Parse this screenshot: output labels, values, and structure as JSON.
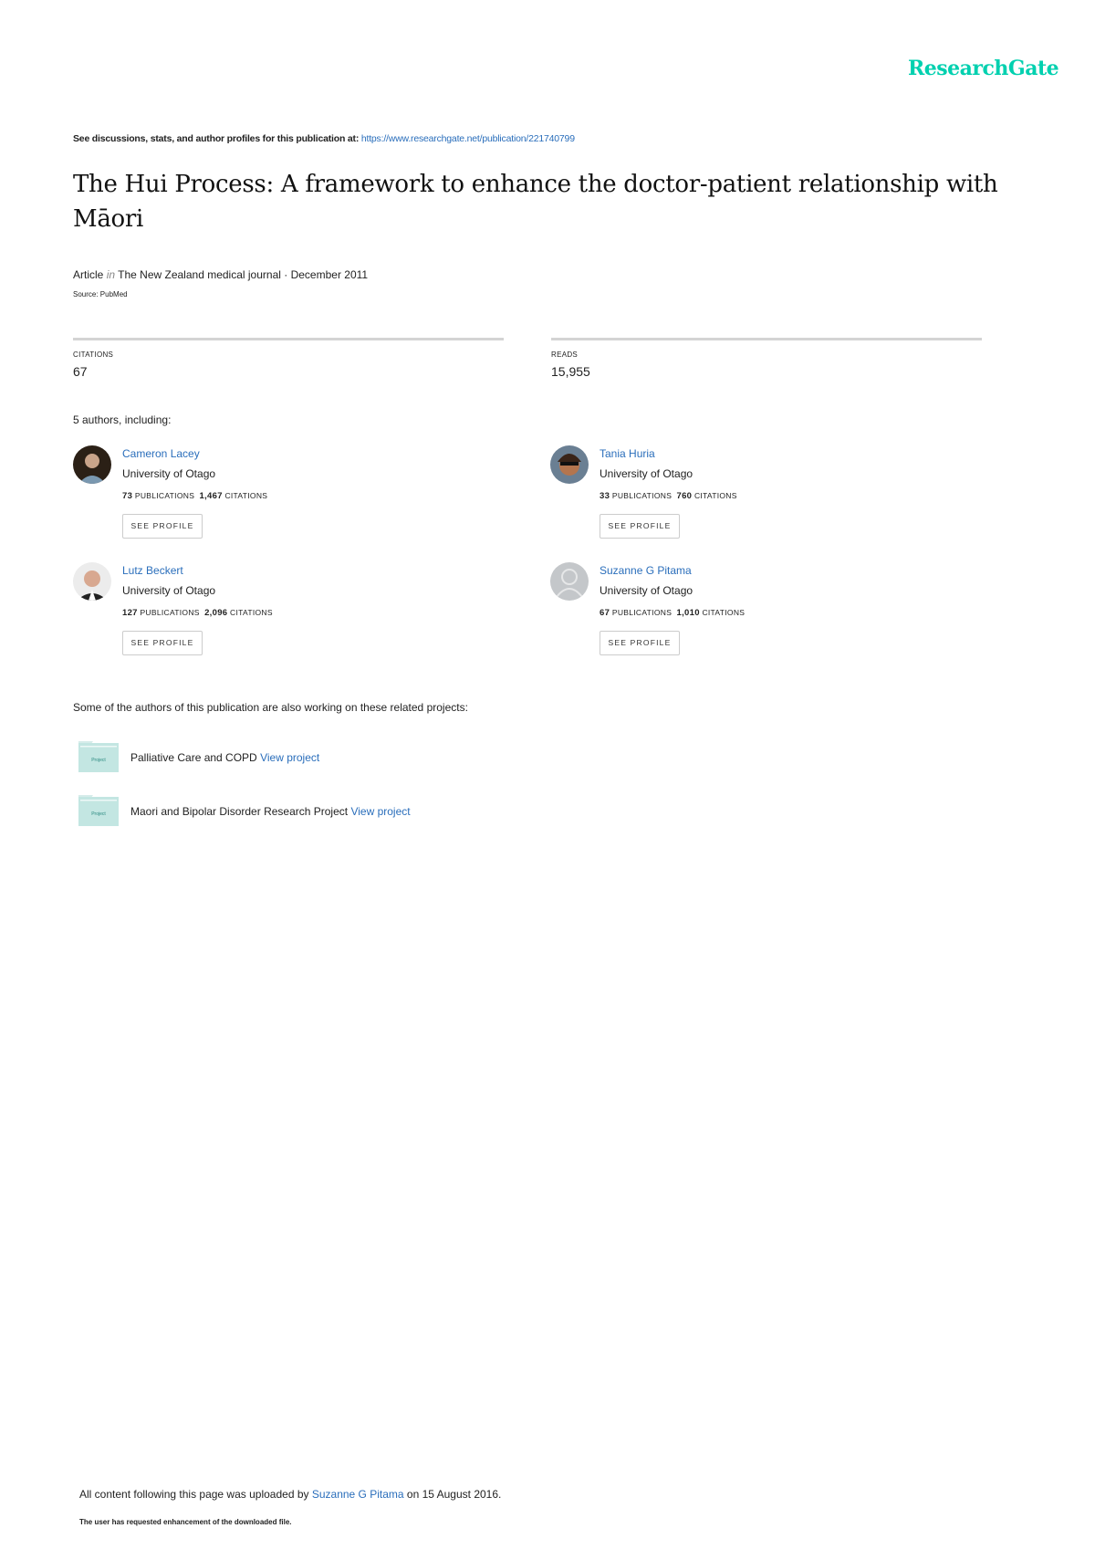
{
  "brand": {
    "logo": "ResearchGate",
    "color": "#00d0af"
  },
  "header": {
    "prefix": "See discussions, stats, and author profiles for this publication at:",
    "url": "https://www.researchgate.net/publication/221740799"
  },
  "publication": {
    "title": "The Hui Process: A framework to enhance the doctor-patient relationship with Māori",
    "type": "Article",
    "in_label": "in",
    "journal": "The New Zealand medical journal",
    "date": "December 2011",
    "source": "Source: PubMed"
  },
  "stats": {
    "citations_label": "CITATIONS",
    "citations": "67",
    "reads_label": "READS",
    "reads": "15,955"
  },
  "authors_heading": "5 authors, including:",
  "authors": [
    {
      "name": "Cameron Lacey",
      "affiliation": "University of Otago",
      "publications": "73",
      "citations": "1,467",
      "pub_label": "PUBLICATIONS",
      "cit_label": "CITATIONS",
      "button": "SEE PROFILE"
    },
    {
      "name": "Tania Huria",
      "affiliation": "University of Otago",
      "publications": "33",
      "citations": "760",
      "pub_label": "PUBLICATIONS",
      "cit_label": "CITATIONS",
      "button": "SEE PROFILE"
    },
    {
      "name": "Lutz Beckert",
      "affiliation": "University of Otago",
      "publications": "127",
      "citations": "2,096",
      "pub_label": "PUBLICATIONS",
      "cit_label": "CITATIONS",
      "button": "SEE PROFILE"
    },
    {
      "name": "Suzanne G Pitama",
      "affiliation": "University of Otago",
      "publications": "67",
      "citations": "1,010",
      "pub_label": "PUBLICATIONS",
      "cit_label": "CITATIONS",
      "button": "SEE PROFILE"
    }
  ],
  "related": {
    "heading": "Some of the authors of this publication are also working on these related projects:",
    "icon_label": "Project",
    "projects": [
      {
        "name": "Palliative Care and COPD",
        "link": "View project"
      },
      {
        "name": "Maori and Bipolar Disorder Research Project",
        "link": "View project"
      }
    ]
  },
  "footer": {
    "prefix": "All content following this page was uploaded by",
    "uploader": "Suzanne G Pitama",
    "suffix": "on 15 August 2016.",
    "note": "The user has requested enhancement of the downloaded file."
  }
}
